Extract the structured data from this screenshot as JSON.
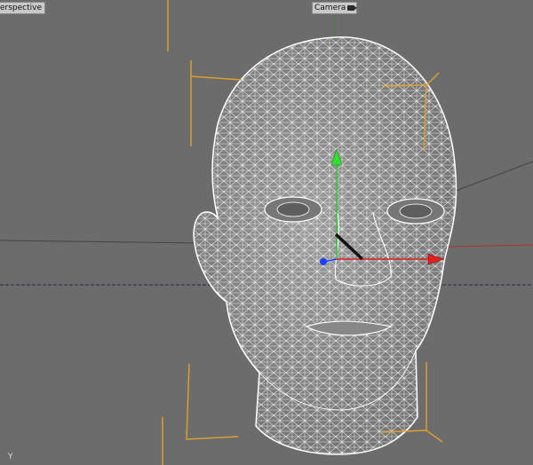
{
  "viewport": {
    "view_name": "erspective",
    "camera_name": "Camera",
    "corner_axis_label": "Y"
  },
  "icons": {
    "camera": "camera-icon",
    "axis_handle_y": "arrow-up-icon",
    "axis_handle_x": "arrow-right-icon",
    "axis_handle_z": "sphere-handle-icon"
  },
  "colors": {
    "viewport_bg": "#6c6c6c",
    "bounding_box": "#e0a030",
    "axis_x": "#e02020",
    "axis_y": "#20c020",
    "axis_z": "#2040ff",
    "wire": "#ffffff"
  }
}
